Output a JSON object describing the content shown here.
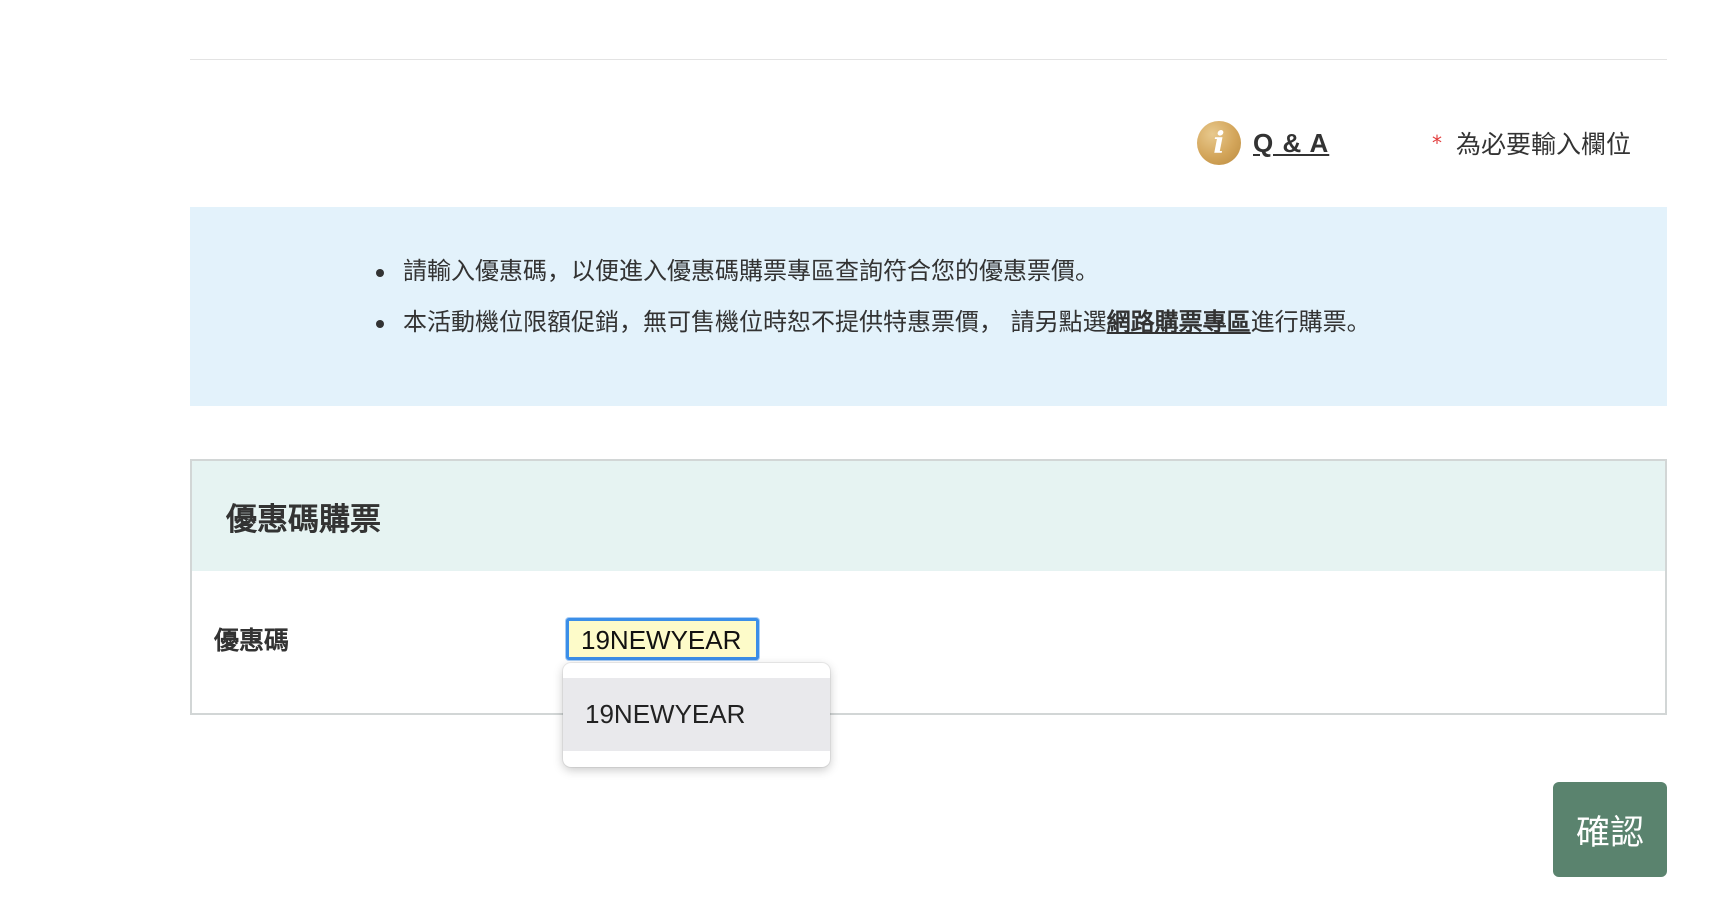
{
  "header": {
    "qa_label": "Q & A",
    "required_star": "*",
    "required_text": "為必要輸入欄位"
  },
  "notice": {
    "line1": "請輸入優惠碼，以便進入優惠碼購票專區查詢符合您的優惠票價。",
    "line2_before": "本活動機位限額促銷，無可售機位時恕不提供特惠票價，  請另點選",
    "line2_link": "網路購票專區",
    "line2_after": "進行購票。"
  },
  "panel": {
    "title": "優惠碼購票",
    "code_label": "優惠碼",
    "code_value": "19NEWYEAR"
  },
  "autocomplete": {
    "options": [
      "19NEWYEAR"
    ]
  },
  "actions": {
    "confirm_label": "確認"
  },
  "icons": {
    "info": "info-icon"
  },
  "colors": {
    "notice_bg": "#e3f2fb",
    "panel_header_bg": "#e6f3f2",
    "confirm_bg": "#5a836e",
    "input_bg": "#fdfbc9",
    "focus_border": "#3b8ee8",
    "info_icon": "#d3a55a",
    "required_star": "#e23b3b"
  }
}
